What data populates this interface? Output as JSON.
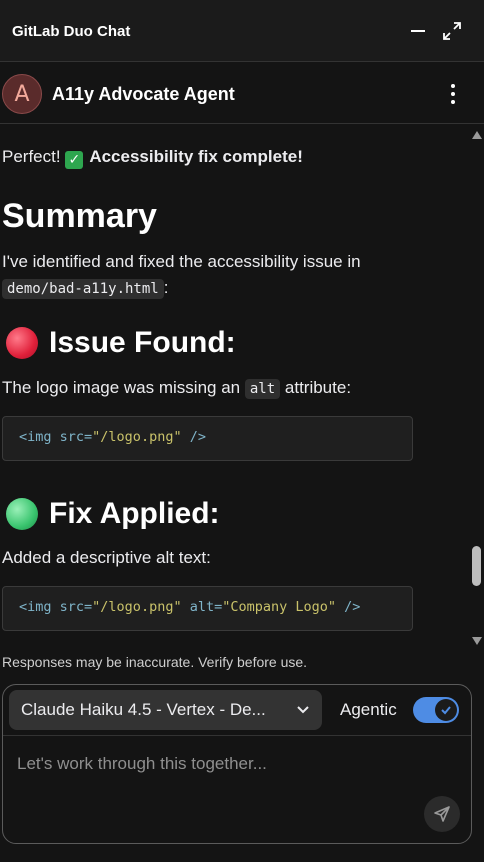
{
  "header": {
    "title": "GitLab Duo Chat",
    "minimize_icon": "minimize-icon",
    "expand_icon": "expand-icon"
  },
  "agent": {
    "avatar_letter": "A",
    "name": "A11y Advocate Agent",
    "menu_icon": "kebab-icon"
  },
  "message": {
    "intro_text": "Perfect!",
    "intro_bold": "Accessibility fix complete!",
    "summary_heading": "Summary",
    "summary_text": "I've identified and fixed the accessibility issue in",
    "summary_file": "demo/bad-a11y.html",
    "summary_colon": ":",
    "issue_heading": "Issue Found:",
    "issue_text_before": "The logo image was missing an",
    "issue_code": "alt",
    "issue_text_after": "attribute:",
    "issue_code_block": {
      "tag_open": "<img",
      "attr_src": "src=",
      "src_value": "\"/logo.png\"",
      "tag_close": "/>"
    },
    "fix_heading": "Fix Applied:",
    "fix_text": "Added a descriptive alt text:",
    "fix_code_block": {
      "tag_open": "<img",
      "attr_src": "src=",
      "src_value": "\"/logo.png\"",
      "attr_alt": "alt=",
      "alt_value": "\"Company Logo\"",
      "tag_close": "/>"
    }
  },
  "disclaimer": "Responses may be inaccurate. Verify before use.",
  "composer": {
    "model_label": "Claude Haiku 4.5 - Vertex - De...",
    "agentic_label": "Agentic",
    "agentic_enabled": true,
    "placeholder": "Let's work through this together...",
    "send_icon": "send-icon"
  },
  "colors": {
    "toggle_on": "#4e8ce4",
    "check_green": "#2ea64f",
    "issue_red": "#e0203a",
    "fix_green": "#39c46e"
  }
}
